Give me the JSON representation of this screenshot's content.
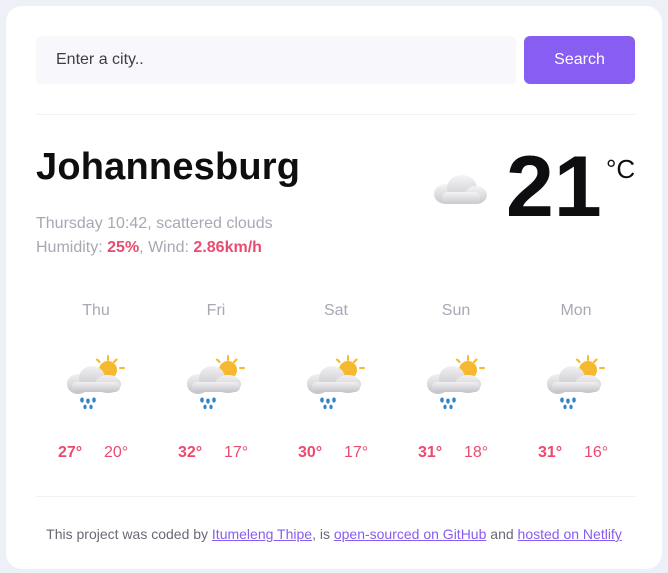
{
  "search": {
    "placeholder": "Enter a city..",
    "button_label": "Search"
  },
  "current": {
    "city": "Johannesburg",
    "day_time": "Thursday 10:42",
    "description": "scattered clouds",
    "humidity_label": "Humidity:",
    "humidity": "25%",
    "wind_label": "Wind:",
    "wind": "2.86km/h",
    "temperature": "21",
    "unit": "°C",
    "icon": "cloud-icon"
  },
  "forecast": [
    {
      "day": "Thu",
      "high": "27°",
      "low": "20°",
      "icon": "rain-sun-icon"
    },
    {
      "day": "Fri",
      "high": "32°",
      "low": "17°",
      "icon": "rain-sun-icon"
    },
    {
      "day": "Sat",
      "high": "30°",
      "low": "17°",
      "icon": "rain-sun-icon"
    },
    {
      "day": "Sun",
      "high": "31°",
      "low": "18°",
      "icon": "rain-sun-icon"
    },
    {
      "day": "Mon",
      "high": "31°",
      "low": "16°",
      "icon": "rain-sun-icon"
    }
  ],
  "footer": {
    "prefix": "This project was coded by",
    "author": "Itumeleng Thipe",
    "middle": ", is",
    "github": "open-sourced on GitHub",
    "and": "and",
    "netlify": "hosted on Netlify"
  },
  "colors": {
    "accent": "#885df1",
    "highlight": "#e94c6e",
    "muted": "#a9a7b4",
    "sun": "#f5b82e",
    "rain": "#2f86c5"
  }
}
